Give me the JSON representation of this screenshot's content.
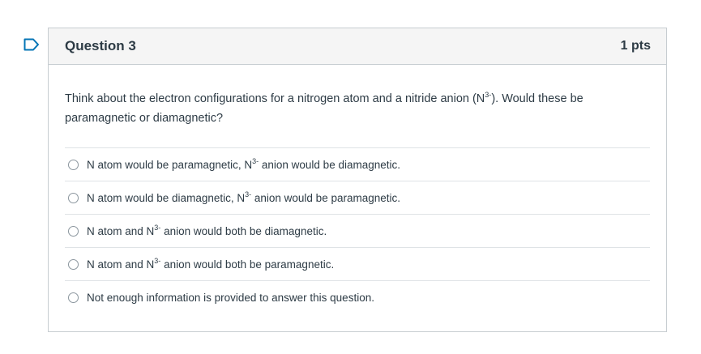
{
  "question": {
    "title": "Question 3",
    "points": "1 pts",
    "text_before": "Think about the electron configurations for a nitrogen atom and a nitride anion (N",
    "text_sup": "3-",
    "text_after": "). Would these be paramagnetic or diamagnetic?"
  },
  "answers": [
    {
      "pre": "N atom would be paramagnetic, N",
      "sup": "3-",
      "post": " anion would be diamagnetic."
    },
    {
      "pre": "N atom would be diamagnetic, N",
      "sup": "3-",
      "post": " anion would be paramagnetic."
    },
    {
      "pre": "N atom and N",
      "sup": "3-",
      "post": " anion would both be diamagnetic."
    },
    {
      "pre": "N atom and N",
      "sup": "3-",
      "post": " anion would both be paramagnetic."
    },
    {
      "pre": "Not enough information is provided to answer this question.",
      "sup": "",
      "post": ""
    }
  ],
  "colors": {
    "flag": "#0374b5",
    "text": "#2d3b45",
    "header_bg": "#f5f5f5",
    "border": "#c7cdd1"
  },
  "icons": {
    "flag": "flag-question-icon"
  }
}
